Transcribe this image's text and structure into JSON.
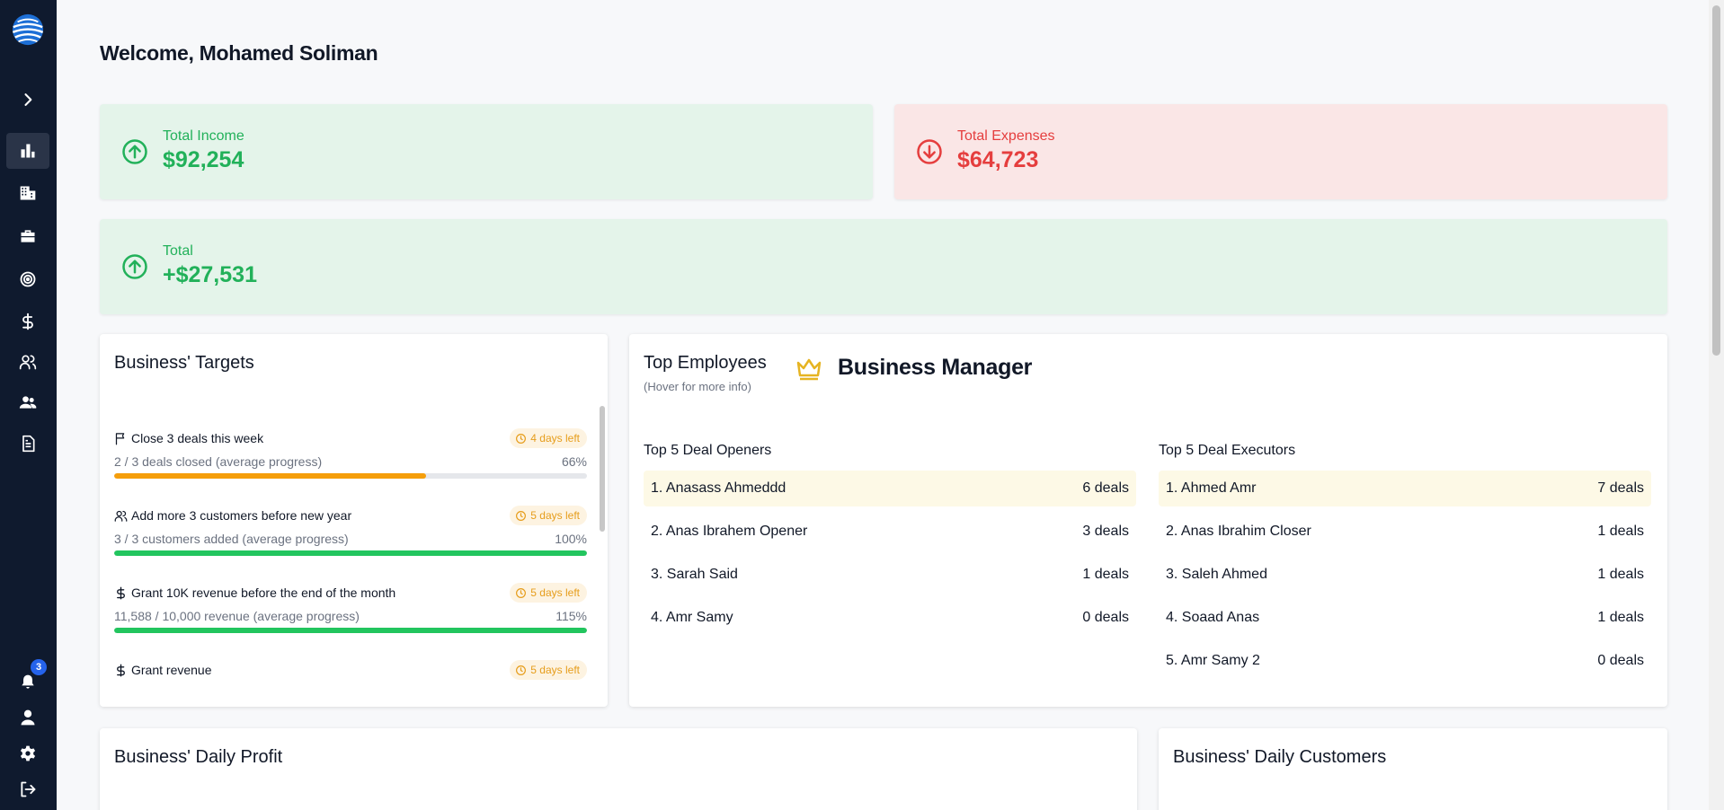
{
  "header": {
    "welcome": "Welcome, Mohamed Soliman"
  },
  "sidebar": {
    "notification_count": "3",
    "items": [
      "chevron-right-icon",
      "chart-icon",
      "building-icon",
      "briefcase-icon",
      "target-icon",
      "dollar-icon",
      "users-icon",
      "people-icon",
      "document-icon"
    ]
  },
  "stats": {
    "income": {
      "label": "Total Income",
      "value": "$92,254"
    },
    "expenses": {
      "label": "Total Expenses",
      "value": "$64,723"
    },
    "total": {
      "label": "Total",
      "value": "+$27,531"
    }
  },
  "colors": {
    "green": "#22b15a",
    "red": "#e53e3e",
    "orange": "#f59e0b",
    "sidebar": "#0f1a2e"
  },
  "targets": {
    "title": "Business' Targets",
    "items": [
      {
        "icon": "flag-icon",
        "title": "Close 3 deals this week",
        "days": "4 days left",
        "sub": "2 / 3 deals closed (average progress)",
        "pct": "66%",
        "progress": 0.66,
        "color": "#f59e0b"
      },
      {
        "icon": "users-icon",
        "title": "Add more 3 customers before new year",
        "days": "5 days left",
        "sub": "3 / 3 customers added (average progress)",
        "pct": "100%",
        "progress": 1.0,
        "color": "#22c55e"
      },
      {
        "icon": "dollar-icon",
        "title": "Grant 10K revenue before the end of the month",
        "days": "5 days left",
        "sub": "11,588 / 10,000 revenue (average progress)",
        "pct": "115%",
        "progress": 1.0,
        "color": "#22c55e"
      },
      {
        "icon": "dollar-icon",
        "title": "Grant revenue",
        "days": "5 days left"
      }
    ]
  },
  "employees": {
    "title": "Top Employees",
    "hint": "(Hover for more info)",
    "manager": "Business Manager",
    "openers": {
      "title": "Top 5 Deal Openers",
      "rows": [
        {
          "name": "1. Anasass Ahmeddd",
          "deals": "6 deals"
        },
        {
          "name": "2. Anas Ibrahem Opener",
          "deals": "3 deals"
        },
        {
          "name": "3. Sarah Said",
          "deals": "1 deals"
        },
        {
          "name": "4. Amr Samy",
          "deals": "0 deals"
        }
      ]
    },
    "executors": {
      "title": "Top 5 Deal Executors",
      "rows": [
        {
          "name": "1. Ahmed Amr",
          "deals": "7 deals"
        },
        {
          "name": "2. Anas Ibrahim Closer",
          "deals": "1 deals"
        },
        {
          "name": "3. Saleh Ahmed",
          "deals": "1 deals"
        },
        {
          "name": "4. Soaad Anas",
          "deals": "1 deals"
        },
        {
          "name": "5. Amr Samy 2",
          "deals": "0 deals"
        }
      ]
    }
  },
  "daily_profit": {
    "title": "Business' Daily Profit"
  },
  "daily_customers": {
    "title": "Business' Daily Customers"
  }
}
